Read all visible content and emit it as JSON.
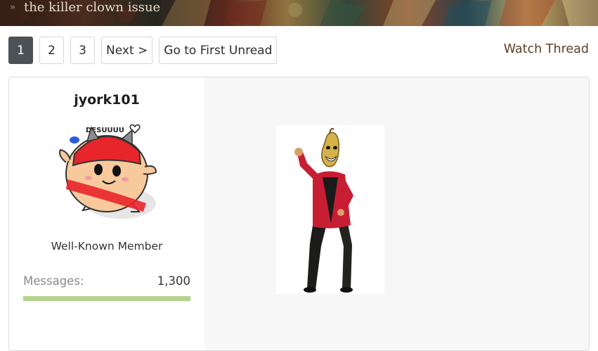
{
  "breadcrumb": {
    "separator": "»",
    "label": "the killer clown issue"
  },
  "pagination": {
    "pages": [
      "1",
      "2",
      "3"
    ],
    "current": "1",
    "next_label": "Next >",
    "first_unread_label": "Go to First Unread"
  },
  "watch_label": "Watch Thread",
  "post": {
    "username": "jyork101",
    "avatar_caption": "DESUUUU",
    "user_title": "Well-Known Member",
    "stats": [
      {
        "key": "Messages:",
        "value": "1,300",
        "level": 1.0
      }
    ]
  },
  "colors": {
    "active_page_bg": "#4c5156",
    "link_brown": "#5b4025",
    "stat_bar": "#b5d38f",
    "content_bg": "#f7f7f7"
  }
}
